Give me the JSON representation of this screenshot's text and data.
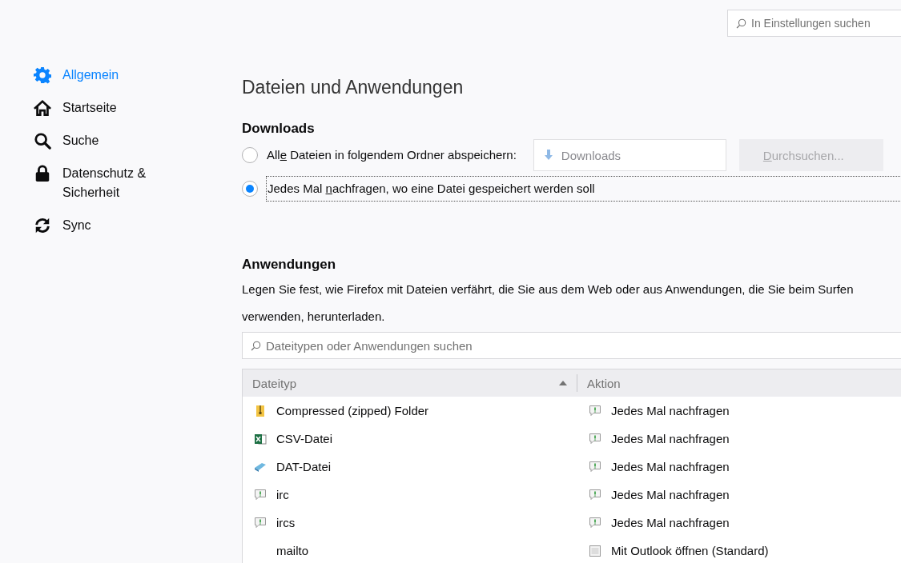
{
  "search": {
    "placeholder": "In Einstellungen suchen"
  },
  "sidebar": {
    "items": [
      {
        "label": "Allgemein",
        "selected": true
      },
      {
        "label": "Startseite",
        "selected": false
      },
      {
        "label": "Suche",
        "selected": false
      },
      {
        "label": "Datenschutz & Sicherheit",
        "selected": false
      },
      {
        "label": "Sync",
        "selected": false
      }
    ]
  },
  "section_title": "Dateien und Anwendungen",
  "downloads": {
    "heading": "Downloads",
    "options": [
      {
        "label_start": "All",
        "access_key": "e",
        "label_end": " Dateien in folgendem Ordner abspeichern:",
        "selected": false,
        "kind": "folder"
      },
      {
        "label_start": "Jedes Mal ",
        "access_key": "n",
        "label_end": "achfragen, wo eine Datei gespeichert werden soll",
        "selected": true,
        "kind": "plain"
      }
    ],
    "folder": "Downloads",
    "browse": {
      "access_key": "D",
      "label_end": "urchsuchen..."
    }
  },
  "applications": {
    "heading": "Anwendungen",
    "description": "Legen Sie fest, wie Firefox mit Dateien verfährt, die Sie aus dem Web oder aus Anwendungen, die Sie beim Surfen verwenden, herunterladen.",
    "search": {
      "placeholder": "Dateitypen oder Anwendungen suchen"
    },
    "table": {
      "columns": [
        "Dateityp",
        "Aktion"
      ],
      "rows": [
        {
          "type": {
            "text": "Compressed (zipped) Folder",
            "kind": "zip"
          },
          "action": {
            "text": "Jedes Mal nachfragen",
            "kind": "ask"
          }
        },
        {
          "type": {
            "text": "CSV-Datei",
            "kind": "csv"
          },
          "action": {
            "text": "Jedes Mal nachfragen",
            "kind": "ask"
          }
        },
        {
          "type": {
            "text": "DAT-Datei",
            "kind": "dat"
          },
          "action": {
            "text": "Jedes Mal nachfragen",
            "kind": "ask"
          }
        },
        {
          "type": {
            "text": "irc",
            "kind": "ask"
          },
          "action": {
            "text": "Jedes Mal nachfragen",
            "kind": "ask"
          }
        },
        {
          "type": {
            "text": "ircs",
            "kind": "ask"
          },
          "action": {
            "text": "Jedes Mal nachfragen",
            "kind": "ask"
          }
        },
        {
          "type": {
            "text": "mailto",
            "kind": "none"
          },
          "action": {
            "text": "Mit Outlook öffnen (Standard)",
            "kind": "app"
          }
        }
      ]
    }
  }
}
